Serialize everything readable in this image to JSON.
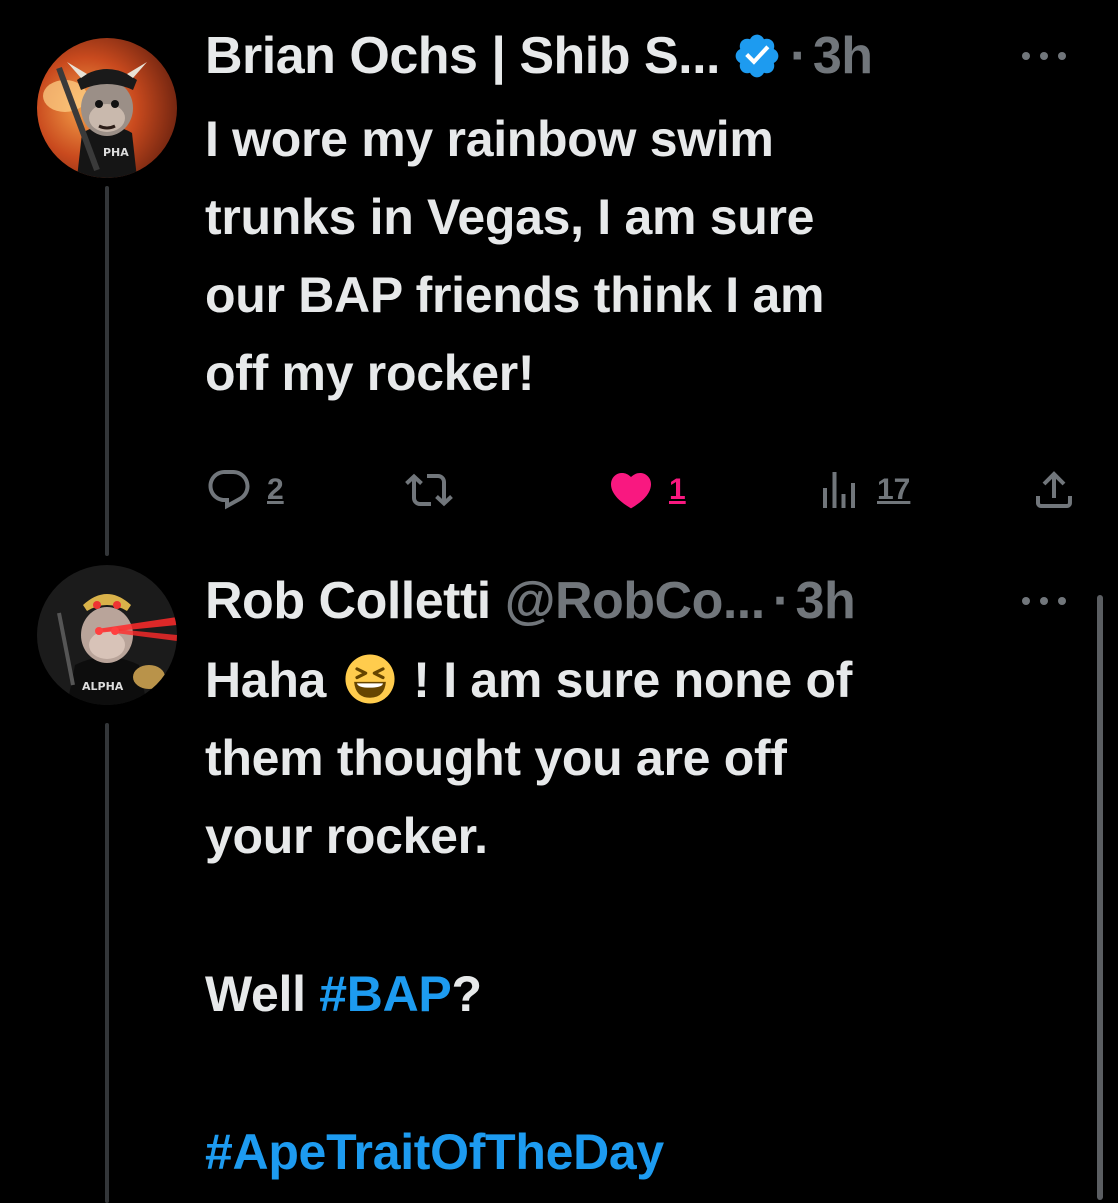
{
  "tweets": [
    {
      "author_name": "Brian Ochs | Shib S...",
      "verified": true,
      "separator": "·",
      "time": "3h",
      "avatar_badge": "PHA",
      "text_lines": [
        "I wore my rainbow swim",
        "trunks in Vegas, I am sure",
        "our BAP friends think I am",
        "off my rocker!"
      ],
      "actions": {
        "reply_count": "2",
        "retweet_count": "",
        "like_count": "1",
        "liked": true,
        "view_count": "17"
      }
    },
    {
      "author_name": "Rob Colletti",
      "handle": "@RobCo...",
      "separator": "·",
      "time": "3h",
      "avatar_badge": "ALPHA",
      "text": {
        "line1_before_emoji": "Haha",
        "emoji": "grinning-squinting-face",
        "line1_after_emoji": "! I am sure none of",
        "line2": "them thought you are off",
        "line3": "your rocker.",
        "line4_text": "Well ",
        "line4_hashtag": "#BAP",
        "line4_end": "?",
        "hashtag2": "#ApeTraitOfTheDay"
      }
    }
  ],
  "colors": {
    "background": "#000000",
    "text": "#e7e9ea",
    "muted": "#71767b",
    "link": "#1d9bf0",
    "like": "#f91880",
    "verified": "#1d9bf0"
  }
}
